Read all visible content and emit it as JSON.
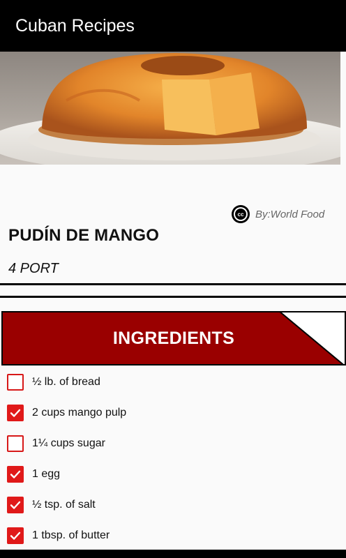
{
  "appbar": {
    "title": "Cuban Recipes"
  },
  "hero": {
    "image": "mango-flan-photo"
  },
  "credit": {
    "icon": "creative-commons-icon",
    "text": "By:World Food"
  },
  "recipe": {
    "title": "PUDÍN DE MANGO",
    "portions": "4 PORT"
  },
  "ingredients": {
    "header": "INGREDIENTS",
    "items": [
      {
        "label": "½ lb. of bread",
        "checked": false
      },
      {
        "label": "2 cups mango pulp",
        "checked": true
      },
      {
        "label": "1¼ cups sugar",
        "checked": false
      },
      {
        "label": "1 egg",
        "checked": true
      },
      {
        "label": "½ tsp. of salt",
        "checked": true
      },
      {
        "label": "1 tbsp. of butter",
        "checked": true
      }
    ]
  },
  "colors": {
    "appbar": "#000000",
    "accent": "#9a0000",
    "checkbox": "#e01919"
  }
}
